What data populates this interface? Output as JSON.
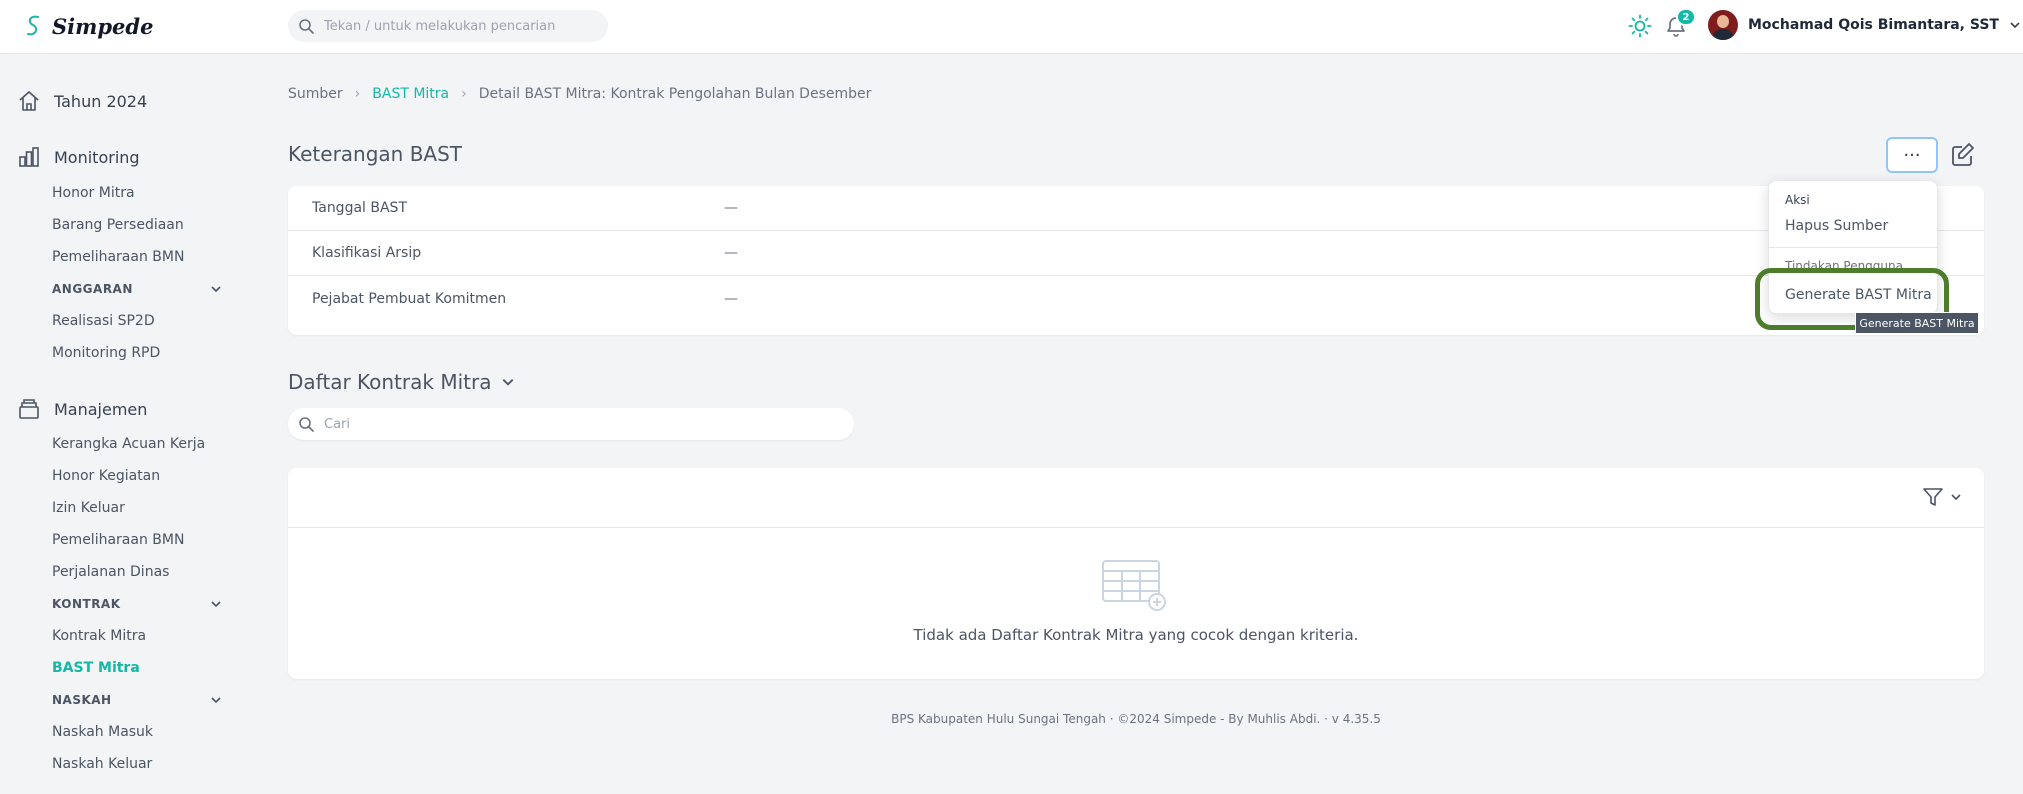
{
  "app": {
    "name": "Simpede"
  },
  "topbar": {
    "search_placeholder": "Tekan / untuk melakukan pencarian",
    "notifications_count": "2",
    "user_name": "Mochamad Qois Bimantara, SST"
  },
  "sidebar": {
    "sections": [
      {
        "label": "Tahun 2024",
        "icon": "home-icon"
      },
      {
        "label": "Monitoring",
        "icon": "bar-chart-icon"
      },
      {
        "label": "Manajemen",
        "icon": "archive-icon"
      }
    ],
    "monitoring_items": [
      "Honor Mitra",
      "Barang Persediaan",
      "Pemeliharaan BMN"
    ],
    "group_anggaran": "ANGGARAN",
    "anggaran_items": [
      "Realisasi SP2D",
      "Monitoring RPD"
    ],
    "manajemen_items": [
      "Kerangka Acuan Kerja",
      "Honor Kegiatan",
      "Izin Keluar",
      "Pemeliharaan BMN",
      "Perjalanan Dinas"
    ],
    "group_kontrak": "KONTRAK",
    "kontrak_items": [
      "Kontrak Mitra",
      "BAST Mitra"
    ],
    "group_naskah": "NASKAH",
    "naskah_items": [
      "Naskah Masuk",
      "Naskah Keluar"
    ]
  },
  "breadcrumb": [
    "Sumber",
    "BAST Mitra",
    "Detail BAST Mitra: Kontrak Pengolahan Bulan Desember"
  ],
  "keterangan": {
    "title": "Keterangan BAST",
    "rows": [
      {
        "label": "Tanggal BAST",
        "value": "—"
      },
      {
        "label": "Klasifikasi Arsip",
        "value": "—"
      },
      {
        "label": "Pejabat Pembuat Komitmen",
        "value": "—"
      }
    ]
  },
  "dropdown": {
    "more_label": "···",
    "header_aksi": "Aksi",
    "item_hapus": "Hapus Sumber",
    "header_tindakan": "Tindakan Pengguna",
    "item_generate": "Generate BAST Mitra",
    "tooltip": "Generate BAST Mitra"
  },
  "daftar": {
    "title": "Daftar Kontrak Mitra",
    "search_placeholder": "Cari",
    "empty_text": "Tidak ada Daftar Kontrak Mitra yang cocok dengan kriteria."
  },
  "footer": "BPS Kabupaten Hulu Sungai Tengah  ·  ©2024 Simpede - By Muhlis Abdi.  ·  v 4.35.5",
  "colors": {
    "accent": "#14b8a6",
    "highlight": "#4d7c2b"
  }
}
